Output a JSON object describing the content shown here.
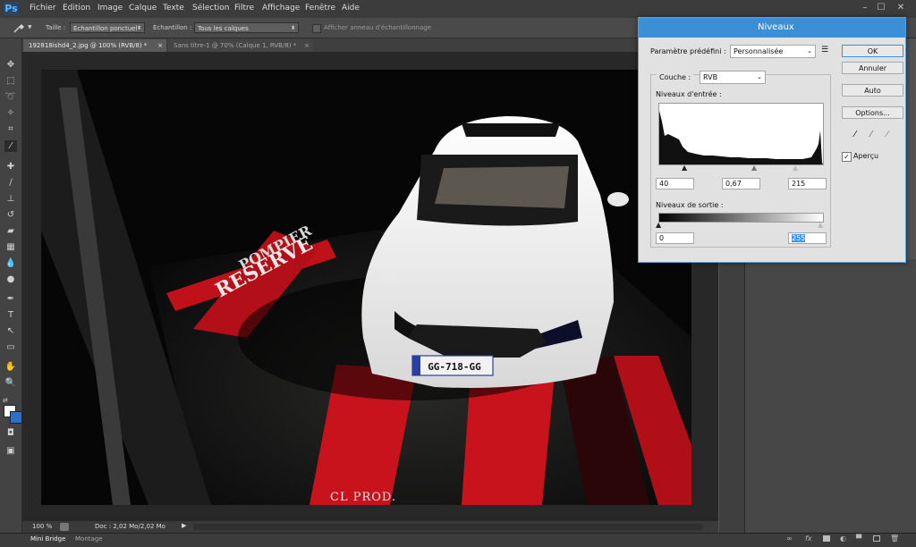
{
  "app": {
    "logo": "Ps"
  },
  "menu": [
    "Fichier",
    "Edition",
    "Image",
    "Calque",
    "Texte",
    "Sélection",
    "Filtre",
    "Affichage",
    "Fenêtre",
    "Aide"
  ],
  "window_controls": {
    "minimize": "–",
    "maximize": "☐",
    "close": "✕"
  },
  "options": {
    "size_label": "Taille :",
    "size_value": "Echantillon ponctuel",
    "sample_label": "Echantillon :",
    "sample_value": "Tous les calques",
    "ring_label": "Afficher anneau d'échantillonnage"
  },
  "tabs": [
    {
      "label": "192818ishd4_2.jpg @ 100% (RVB/8) *",
      "close": "×"
    },
    {
      "label": "Sans titre-1 @ 70% (Calque 1, RVB/8) *",
      "close": "×"
    }
  ],
  "photo": {
    "plate": "GG-718-GG",
    "credit": "CL PROD.",
    "floor_text_1": "RESERVE",
    "floor_text_2": "POMPIER"
  },
  "status": {
    "zoom": "100 %",
    "doc": "Doc : 2,02 Mo/2,02 Mo"
  },
  "bottom_tabs": [
    "Mini Bridge",
    "Montage"
  ],
  "dialog": {
    "title": "Niveaux",
    "preset_label": "Paramètre prédéfini :",
    "preset_value": "Personnalisée",
    "channel_label": "Couche :",
    "channel_value": "RVB",
    "input_levels_label": "Niveaux d'entrée :",
    "input_black": "40",
    "input_gamma": "0,67",
    "input_white": "215",
    "output_levels_label": "Niveaux de sortie :",
    "output_black": "0",
    "output_white": "255",
    "buttons": {
      "ok": "OK",
      "reset": "Annuler",
      "auto": "Auto",
      "options": "Options..."
    },
    "preview_label": "Aperçu",
    "preview_checked": true
  }
}
